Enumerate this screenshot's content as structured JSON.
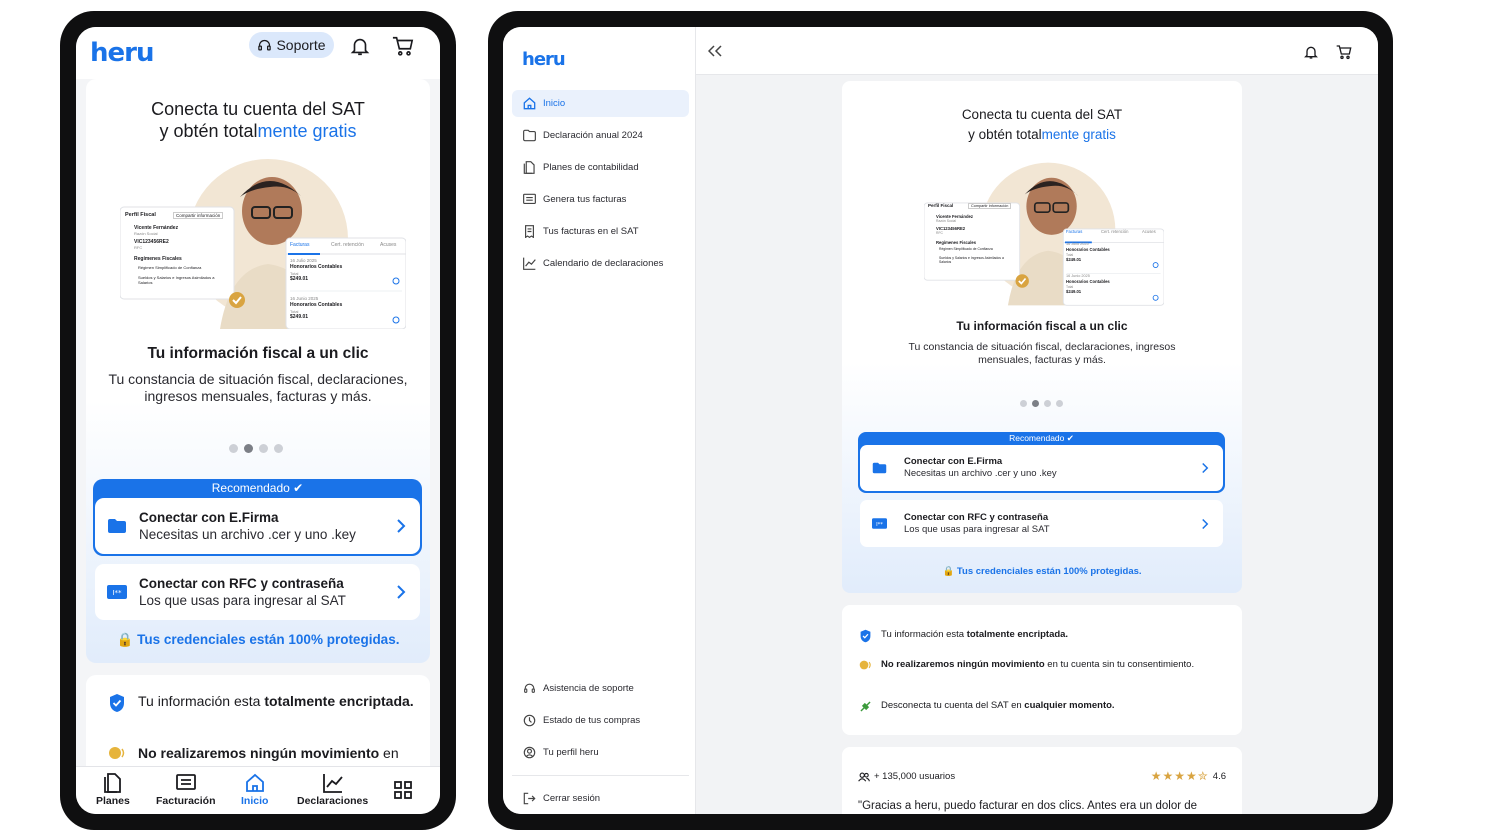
{
  "brand": {
    "logo": "heru",
    "accent": "#1a73e8"
  },
  "phone": {
    "header": {
      "support_label": "Soporte"
    },
    "hero": {
      "title_line1": "Conecta tu cuenta del SAT",
      "title_line2_pre": "y obtén total",
      "title_line2_highlight": "mente gratis",
      "subtitle": "Tu información fiscal a un clic",
      "description": "Tu constancia de situación fiscal, declaraciones, ingresos mensuales, facturas y más."
    },
    "recommended_label": "Recomendado",
    "options": [
      {
        "title": "Conectar con E.Firma",
        "subtitle": "Necesitas un archivo .cer y uno .key"
      },
      {
        "title": "Conectar con RFC y contraseña",
        "subtitle": "Los que usas para ingresar al SAT"
      }
    ],
    "secure_note": "Tus credenciales están 100% protegidas.",
    "benefits": {
      "b1_pre": "Tu información esta ",
      "b1_bold": "totalmente encriptada.",
      "b2_bold": "No realizaremos ningún movimiento",
      "b2_post": " en"
    },
    "tabbar": [
      {
        "label": "Planes",
        "icon": "document-icon"
      },
      {
        "label": "Facturación",
        "icon": "invoice-icon"
      },
      {
        "label": "Inicio",
        "icon": "home-icon",
        "active": true
      },
      {
        "label": "Declaraciones",
        "icon": "chart-icon"
      },
      {
        "label": "",
        "icon": "grid-icon"
      }
    ]
  },
  "illustration": {
    "profile_title": "Perfil Fiscal",
    "share_button": "Compartir información",
    "name": "Vicente Fernández",
    "name_caption": "Razón Social",
    "rfc": "VIC123456RE2",
    "rfc_caption": "RFC",
    "regimes_title": "Regímenes Fiscales",
    "regime1": "Régimen Simplificado de Confianza",
    "regime2": "Sueldos y Salarios e Ingresos Asimilados a Salarios",
    "tabs": [
      "Facturas",
      "Cert. retención",
      "Acuses"
    ],
    "invoice1_date": "16 Julio 2025",
    "invoice1_title": "Honorarios Contables",
    "invoice1_caption": "Total",
    "invoice1_amount": "$249.01",
    "invoice2_date": "16 Junio 2025",
    "invoice2_title": "Honorarios Contables",
    "invoice2_caption": "Total",
    "invoice2_amount": "$249.01"
  },
  "tablet": {
    "sidebar": {
      "items": [
        {
          "label": "Inicio",
          "icon": "home-icon",
          "active": true
        },
        {
          "label": "Declaración anual 2024",
          "icon": "folder-icon"
        },
        {
          "label": "Planes de contabilidad",
          "icon": "document-icon"
        },
        {
          "label": "Genera tus facturas",
          "icon": "invoice-icon"
        },
        {
          "label": "Tus facturas en el SAT",
          "icon": "receipt-icon"
        },
        {
          "label": "Calendario de declaraciones",
          "icon": "chart-icon"
        }
      ],
      "bottom_items": [
        {
          "label": "Asistencia de soporte",
          "icon": "headset-icon"
        },
        {
          "label": "Estado de tus compras",
          "icon": "purchases-icon"
        },
        {
          "label": "Tu perfil heru",
          "icon": "user-icon"
        }
      ],
      "logout": "Cerrar sesión"
    },
    "benefits": {
      "b1_pre": "Tu información esta ",
      "b1_bold": "totalmente encriptada.",
      "b2_bold": "No realizaremos ningún movimiento",
      "b2_post": " en tu cuenta sin tu consentimiento.",
      "b3_pre": "Desconecta tu cuenta del SAT en ",
      "b3_bold": "cualquier momento."
    },
    "reviews": {
      "users": "+ 135,000 usuarios",
      "rating": "4.6",
      "stars_value": 4.5,
      "quote": "\"Gracias a heru, puedo facturar en dos clics. Antes era un dolor de cabeza, ahora es parte de mi rutina y no me preocupa en lo"
    }
  }
}
